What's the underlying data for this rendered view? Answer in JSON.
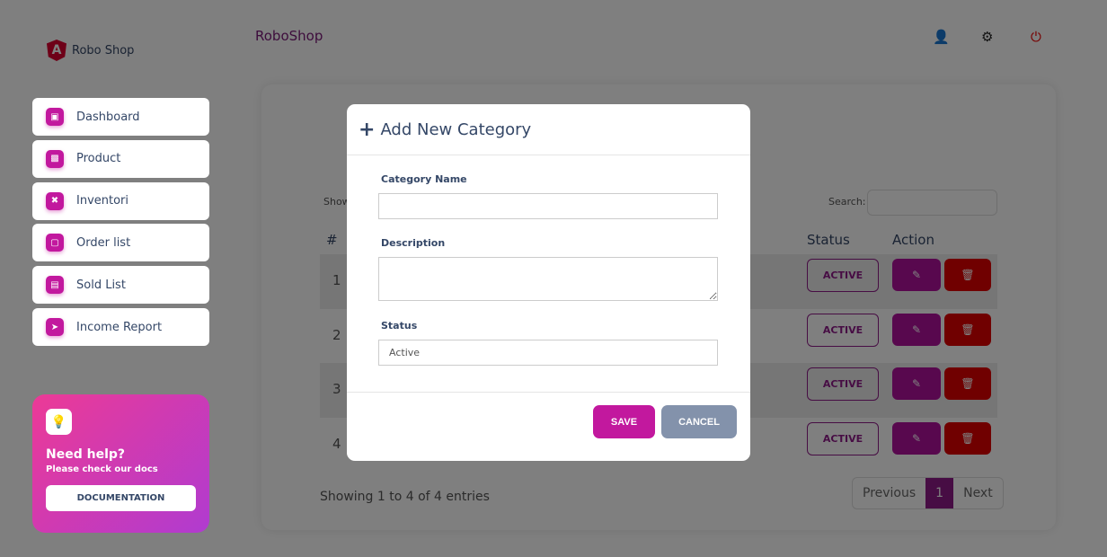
{
  "app": {
    "logo_text": "Robo Shop",
    "brand": "RoboShop"
  },
  "header_icons": [
    "user-icon",
    "gear-icon",
    "power-icon"
  ],
  "sidebar": {
    "items": [
      {
        "label": "Dashboard",
        "icon": "shop-icon"
      },
      {
        "label": "Product",
        "icon": "chart-icon"
      },
      {
        "label": "Inventori",
        "icon": "tools-icon"
      },
      {
        "label": "Order list",
        "icon": "document-icon"
      },
      {
        "label": "Sold List",
        "icon": "card-icon"
      },
      {
        "label": "Income Report",
        "icon": "rocket-icon"
      }
    ]
  },
  "help": {
    "title": "Need help?",
    "subtitle": "Please check our docs",
    "button": "DOCUMENTATION"
  },
  "table": {
    "show_label": "Show",
    "search_label": "Search:",
    "columns": {
      "num": "#",
      "status": "Status",
      "action": "Action"
    },
    "rows": [
      {
        "num": "1",
        "status": "ACTIVE"
      },
      {
        "num": "2",
        "status": "ACTIVE"
      },
      {
        "num": "3",
        "status": "ACTIVE"
      },
      {
        "num": "4",
        "status": "ACTIVE"
      }
    ],
    "info": "Showing 1 to 4 of 4 entries",
    "pagination": {
      "prev": "Previous",
      "current": "1",
      "next": "Next"
    }
  },
  "modal": {
    "title": "Add New Category",
    "fields": {
      "name_label": "Category Name",
      "name_value": "",
      "desc_label": "Description",
      "desc_value": "",
      "status_label": "Status",
      "status_value": "Active"
    },
    "save": "SAVE",
    "cancel": "CANCEL"
  },
  "colors": {
    "accent": "#c2189e",
    "danger": "#e00000",
    "brand": "#8e1b88",
    "cancel": "#8392ab"
  }
}
